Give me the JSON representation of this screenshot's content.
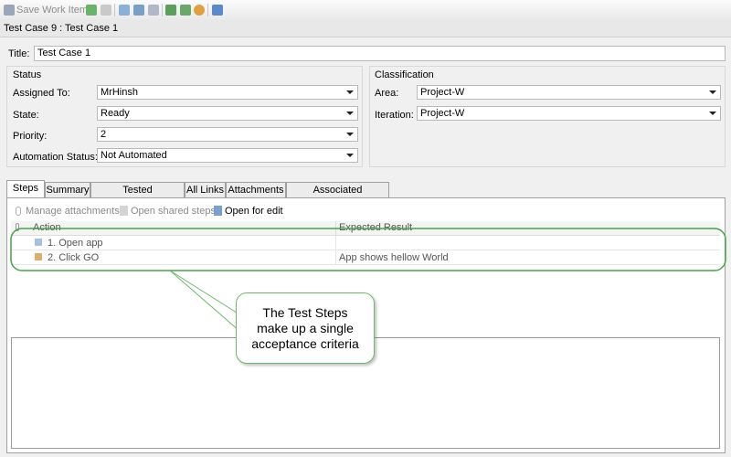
{
  "toolbar": {
    "save_label": "Save Work Item",
    "icons": [
      "refresh-icon",
      "undo-icon",
      "copy-icon",
      "link-icon",
      "sync-icon",
      "new-item-icon",
      "report-icon",
      "settings-icon",
      "help-icon"
    ]
  },
  "header": {
    "title": "Test Case 9 : Test Case 1"
  },
  "form": {
    "title_label": "Title:",
    "title_value": "Test Case 1",
    "status": {
      "heading": "Status",
      "assigned_to_label": "Assigned To:",
      "assigned_to_value": "MrHinsh",
      "state_label": "State:",
      "state_value": "Ready",
      "priority_label": "Priority:",
      "priority_value": "2",
      "automation_label": "Automation Status:",
      "automation_value": "Not Automated"
    },
    "classification": {
      "heading": "Classification",
      "area_label": "Area:",
      "area_value": "Project-W",
      "iteration_label": "Iteration:",
      "iteration_value": "Project-W"
    }
  },
  "tabs": [
    {
      "label": "Steps"
    },
    {
      "label": "Summary"
    },
    {
      "label": "Tested Requirements"
    },
    {
      "label": "All Links"
    },
    {
      "label": "Attachments"
    },
    {
      "label": "Associated Automation"
    }
  ],
  "steps": {
    "manage_attachments": "Manage attachments",
    "open_shared_steps": "Open shared steps",
    "open_for_edit": "Open for edit",
    "col_action": "Action",
    "col_expected": "Expected Result",
    "rows": [
      {
        "action": "1. Open app",
        "expected": ""
      },
      {
        "action": "2. Click GO",
        "expected": "App shows hellow World"
      }
    ]
  },
  "callout": {
    "line1": "The Test Steps",
    "line2": "make up a single",
    "line3": "acceptance criteria"
  },
  "colors": {
    "accent_green": "#4aa04a",
    "border": "#a0a0a0"
  }
}
